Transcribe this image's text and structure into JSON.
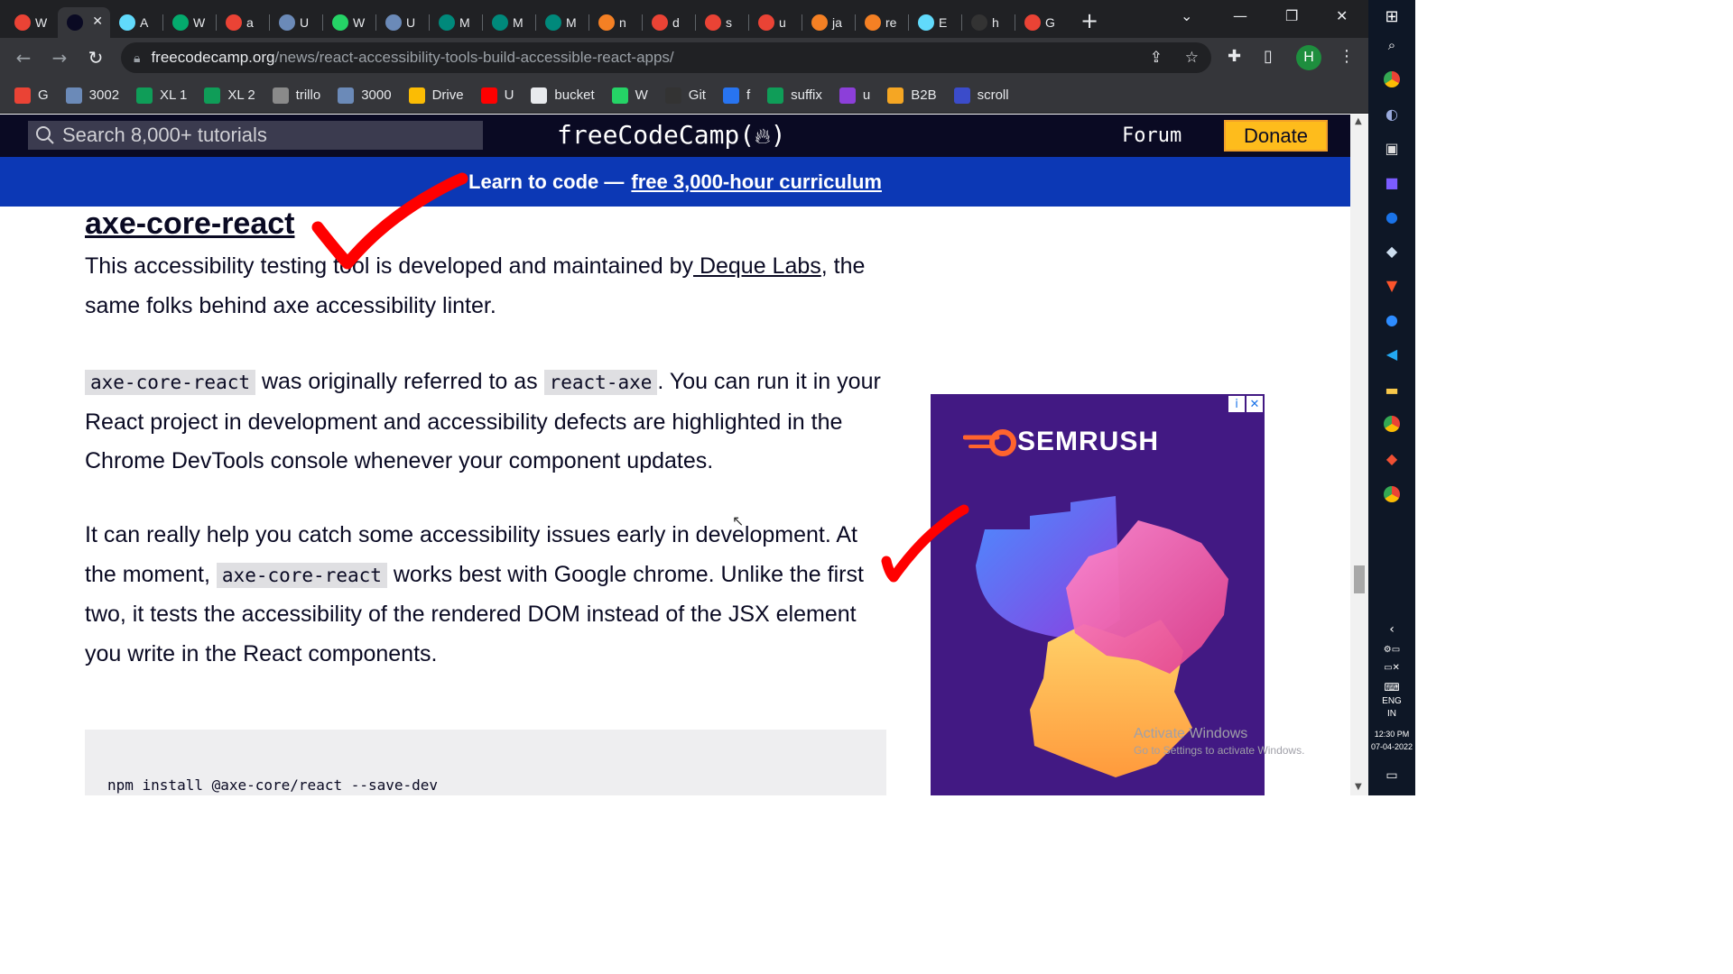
{
  "browser": {
    "tabs": [
      {
        "label": "W",
        "icon": "google-icon",
        "color": "#ea4335"
      },
      {
        "label": "",
        "icon": "freecodecamp-icon",
        "color": "#0a0a23",
        "active": true
      },
      {
        "label": "A",
        "icon": "react-icon",
        "color": "#61dafb"
      },
      {
        "label": "W",
        "icon": "w3schools-icon",
        "color": "#04aa6d"
      },
      {
        "label": "a",
        "icon": "google-icon",
        "color": "#ea4335"
      },
      {
        "label": "U",
        "icon": "bookmark-site-icon",
        "color": "#6b8ab8"
      },
      {
        "label": "W",
        "icon": "whatsapp-icon",
        "color": "#25d366"
      },
      {
        "label": "U",
        "icon": "bookmark-site-icon",
        "color": "#6b8ab8"
      },
      {
        "label": "M",
        "icon": "meet-icon",
        "color": "#00897b"
      },
      {
        "label": "M",
        "icon": "meet-icon",
        "color": "#00897b"
      },
      {
        "label": "M",
        "icon": "meet-icon",
        "color": "#00897b"
      },
      {
        "label": "n",
        "icon": "stackoverflow-icon",
        "color": "#f48024"
      },
      {
        "label": "d",
        "icon": "gmail-icon",
        "color": "#ea4335"
      },
      {
        "label": "s",
        "icon": "google-icon",
        "color": "#ea4335"
      },
      {
        "label": "u",
        "icon": "google-icon",
        "color": "#ea4335"
      },
      {
        "label": "ja",
        "icon": "stackoverflow-icon",
        "color": "#f48024"
      },
      {
        "label": "re",
        "icon": "stackoverflow-icon",
        "color": "#f48024"
      },
      {
        "label": "E",
        "icon": "react-icon",
        "color": "#61dafb"
      },
      {
        "label": "h",
        "icon": "github-icon",
        "color": "#333333"
      },
      {
        "label": "G",
        "icon": "google-icon",
        "color": "#ea4335"
      }
    ],
    "url_host": "freecodecamp.org",
    "url_path": "/news/react-accessibility-tools-build-accessible-react-apps/",
    "profile_initial": "H",
    "bookmarks": [
      {
        "label": "G",
        "icon": "gmail-icon",
        "color": "#ea4335"
      },
      {
        "label": "3002",
        "icon": "bookmark-site-icon",
        "color": "#6b8ab8"
      },
      {
        "label": "XL 1",
        "icon": "sheets-icon",
        "color": "#0f9d58"
      },
      {
        "label": "XL 2",
        "icon": "sheets-icon",
        "color": "#0f9d58"
      },
      {
        "label": "trillo",
        "icon": "trello-icon",
        "color": "#8a8a8a"
      },
      {
        "label": "3000",
        "icon": "bookmark-site-icon",
        "color": "#6b8ab8"
      },
      {
        "label": "Drive",
        "icon": "drive-icon",
        "color": "#fbbc04"
      },
      {
        "label": "U",
        "icon": "youtube-icon",
        "color": "#ff0000"
      },
      {
        "label": "bucket",
        "icon": "globe-icon",
        "color": "#e8eaed"
      },
      {
        "label": "W",
        "icon": "whatsapp-icon",
        "color": "#25d366"
      },
      {
        "label": "Git",
        "icon": "github-icon",
        "color": "#333333"
      },
      {
        "label": "f",
        "icon": "flipkart-icon",
        "color": "#2874f0"
      },
      {
        "label": "suffix",
        "icon": "sheets-icon",
        "color": "#0f9d58"
      },
      {
        "label": "u",
        "icon": "bookmark-site-icon",
        "color": "#8c3fd9"
      },
      {
        "label": "B2B",
        "icon": "bookmark-site-icon",
        "color": "#f5a623"
      },
      {
        "label": "scroll",
        "icon": "bookmark-site-icon",
        "color": "#3b4cca"
      }
    ]
  },
  "site": {
    "search_placeholder": "Search 8,000+ tutorials",
    "logo": "freeCodeCamp(",
    "logo_close": ")",
    "forum": "Forum",
    "donate": "Donate",
    "banner_text": "Learn to code —",
    "banner_link": "free 3,000-hour curriculum"
  },
  "article": {
    "heading": "axe-core-react",
    "p1_a": "This accessibility testing tool is developed and maintained by",
    "p1_link": " Deque Labs",
    "p1_b": ", the same folks behind axe accessibility linter.",
    "p2_code1": "axe-core-react",
    "p2_a": " was originally referred to as ",
    "p2_code2": "react-axe",
    "p2_b": ". You can run it in your React project in development and accessibility defects are highlighted in the Chrome DevTools console whenever your component updates.",
    "p3_a": "It can really help you catch some accessibility issues early in development. At the moment, ",
    "p3_code": "axe-core-react",
    "p3_b": " works best with Google chrome. Unlike the first two, it tests the accessibility of the rendered DOM instead of the JSX element you write in the React components.",
    "code_block": "npm install @axe-core/react --save-dev"
  },
  "ad": {
    "brand": "SEMRUSH",
    "info": "i",
    "close": "✕"
  },
  "os": {
    "activate_title": "Activate Windows",
    "activate_sub": "Go to Settings to activate Windows.",
    "lang": "ENG",
    "region": "IN",
    "time": "12:30 PM",
    "date": "07-04-2022"
  },
  "colors": {
    "annotation_red": "#ff0000",
    "fcc_dark": "#0a0a23",
    "banner_blue": "#0c38b5",
    "donate_yellow": "#febc1c",
    "ad_purple": "#421983"
  }
}
